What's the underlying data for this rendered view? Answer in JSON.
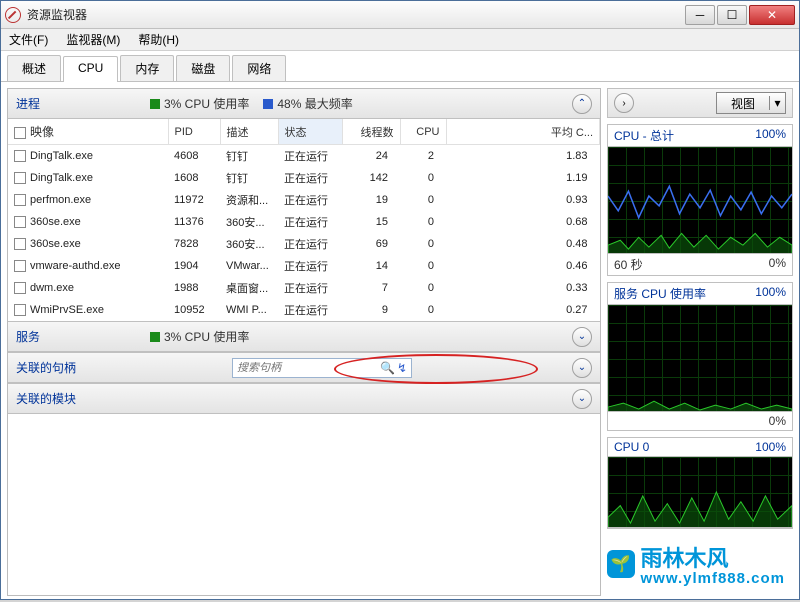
{
  "window": {
    "title": "资源监视器"
  },
  "menubar": {
    "file": "文件(F)",
    "monitor": "监视器(M)",
    "help": "帮助(H)"
  },
  "tabs": {
    "overview": "概述",
    "cpu": "CPU",
    "memory": "内存",
    "disk": "磁盘",
    "network": "网络"
  },
  "processes": {
    "title": "进程",
    "cpu_usage": "3% CPU 使用率",
    "max_freq": "48% 最大频率",
    "cols": {
      "image": "映像",
      "pid": "PID",
      "desc": "描述",
      "status": "状态",
      "threads": "线程数",
      "cpu": "CPU",
      "avg": "平均 C..."
    },
    "rows": [
      {
        "image": "DingTalk.exe",
        "pid": "4608",
        "desc": "钉钉",
        "status": "正在运行",
        "threads": "24",
        "cpu": "2",
        "avg": "1.83"
      },
      {
        "image": "DingTalk.exe",
        "pid": "1608",
        "desc": "钉钉",
        "status": "正在运行",
        "threads": "142",
        "cpu": "0",
        "avg": "1.19"
      },
      {
        "image": "perfmon.exe",
        "pid": "11972",
        "desc": "资源和...",
        "status": "正在运行",
        "threads": "19",
        "cpu": "0",
        "avg": "0.93"
      },
      {
        "image": "360se.exe",
        "pid": "11376",
        "desc": "360安...",
        "status": "正在运行",
        "threads": "15",
        "cpu": "0",
        "avg": "0.68"
      },
      {
        "image": "360se.exe",
        "pid": "7828",
        "desc": "360安...",
        "status": "正在运行",
        "threads": "69",
        "cpu": "0",
        "avg": "0.48"
      },
      {
        "image": "vmware-authd.exe",
        "pid": "1904",
        "desc": "VMwar...",
        "status": "正在运行",
        "threads": "14",
        "cpu": "0",
        "avg": "0.46"
      },
      {
        "image": "dwm.exe",
        "pid": "1988",
        "desc": "桌面窗...",
        "status": "正在运行",
        "threads": "7",
        "cpu": "0",
        "avg": "0.33"
      },
      {
        "image": "WmiPrvSE.exe",
        "pid": "10952",
        "desc": "WMI P...",
        "status": "正在运行",
        "threads": "9",
        "cpu": "0",
        "avg": "0.27"
      }
    ]
  },
  "services": {
    "title": "服务",
    "cpu_usage": "3% CPU 使用率"
  },
  "handles": {
    "title": "关联的句柄",
    "search_placeholder": "搜索句柄"
  },
  "modules": {
    "title": "关联的模块"
  },
  "rightpanel": {
    "view": "视图",
    "graph1": {
      "title": "CPU - 总计",
      "max": "100%",
      "min": "0%",
      "footer_left": "60 秒"
    },
    "graph2": {
      "title": "服务 CPU 使用率",
      "max": "100%",
      "min": "0%"
    },
    "graph3": {
      "title": "CPU 0",
      "max": "100%"
    }
  },
  "watermark": {
    "brand": "雨林木风",
    "url": "www.ylmf888.com"
  }
}
